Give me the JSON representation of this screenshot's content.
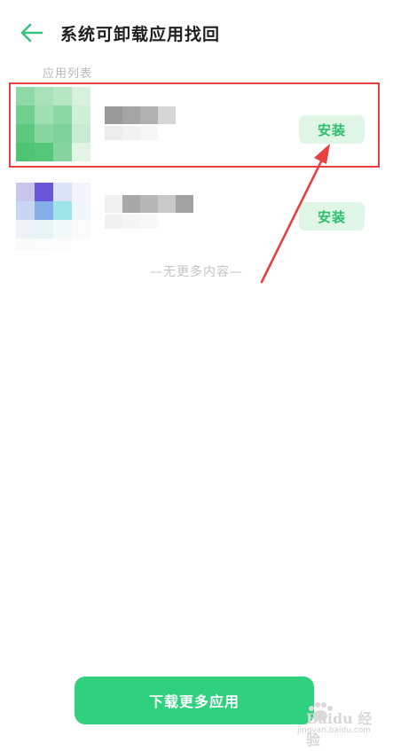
{
  "header": {
    "title": "系统可卸载应用找回"
  },
  "list": {
    "section_label": "应用列表",
    "items": [
      {
        "install_label": "安装"
      },
      {
        "install_label": "安装"
      }
    ],
    "end_text": "—无更多内容—"
  },
  "footer": {
    "download_more_label": "下载更多应用"
  },
  "watermark": {
    "brand": "Baidu 经验",
    "url": "jingyan.baidu.com"
  },
  "colors": {
    "accent_green": "#2fd07e",
    "install_bg": "#dff5e6",
    "install_text": "#2dbf6b",
    "highlight_red": "#e8403f"
  },
  "icons": {
    "back": "arrow-left-icon",
    "annotation": "red-arrow-annotation",
    "watermark": "baidu-paw-icon"
  }
}
